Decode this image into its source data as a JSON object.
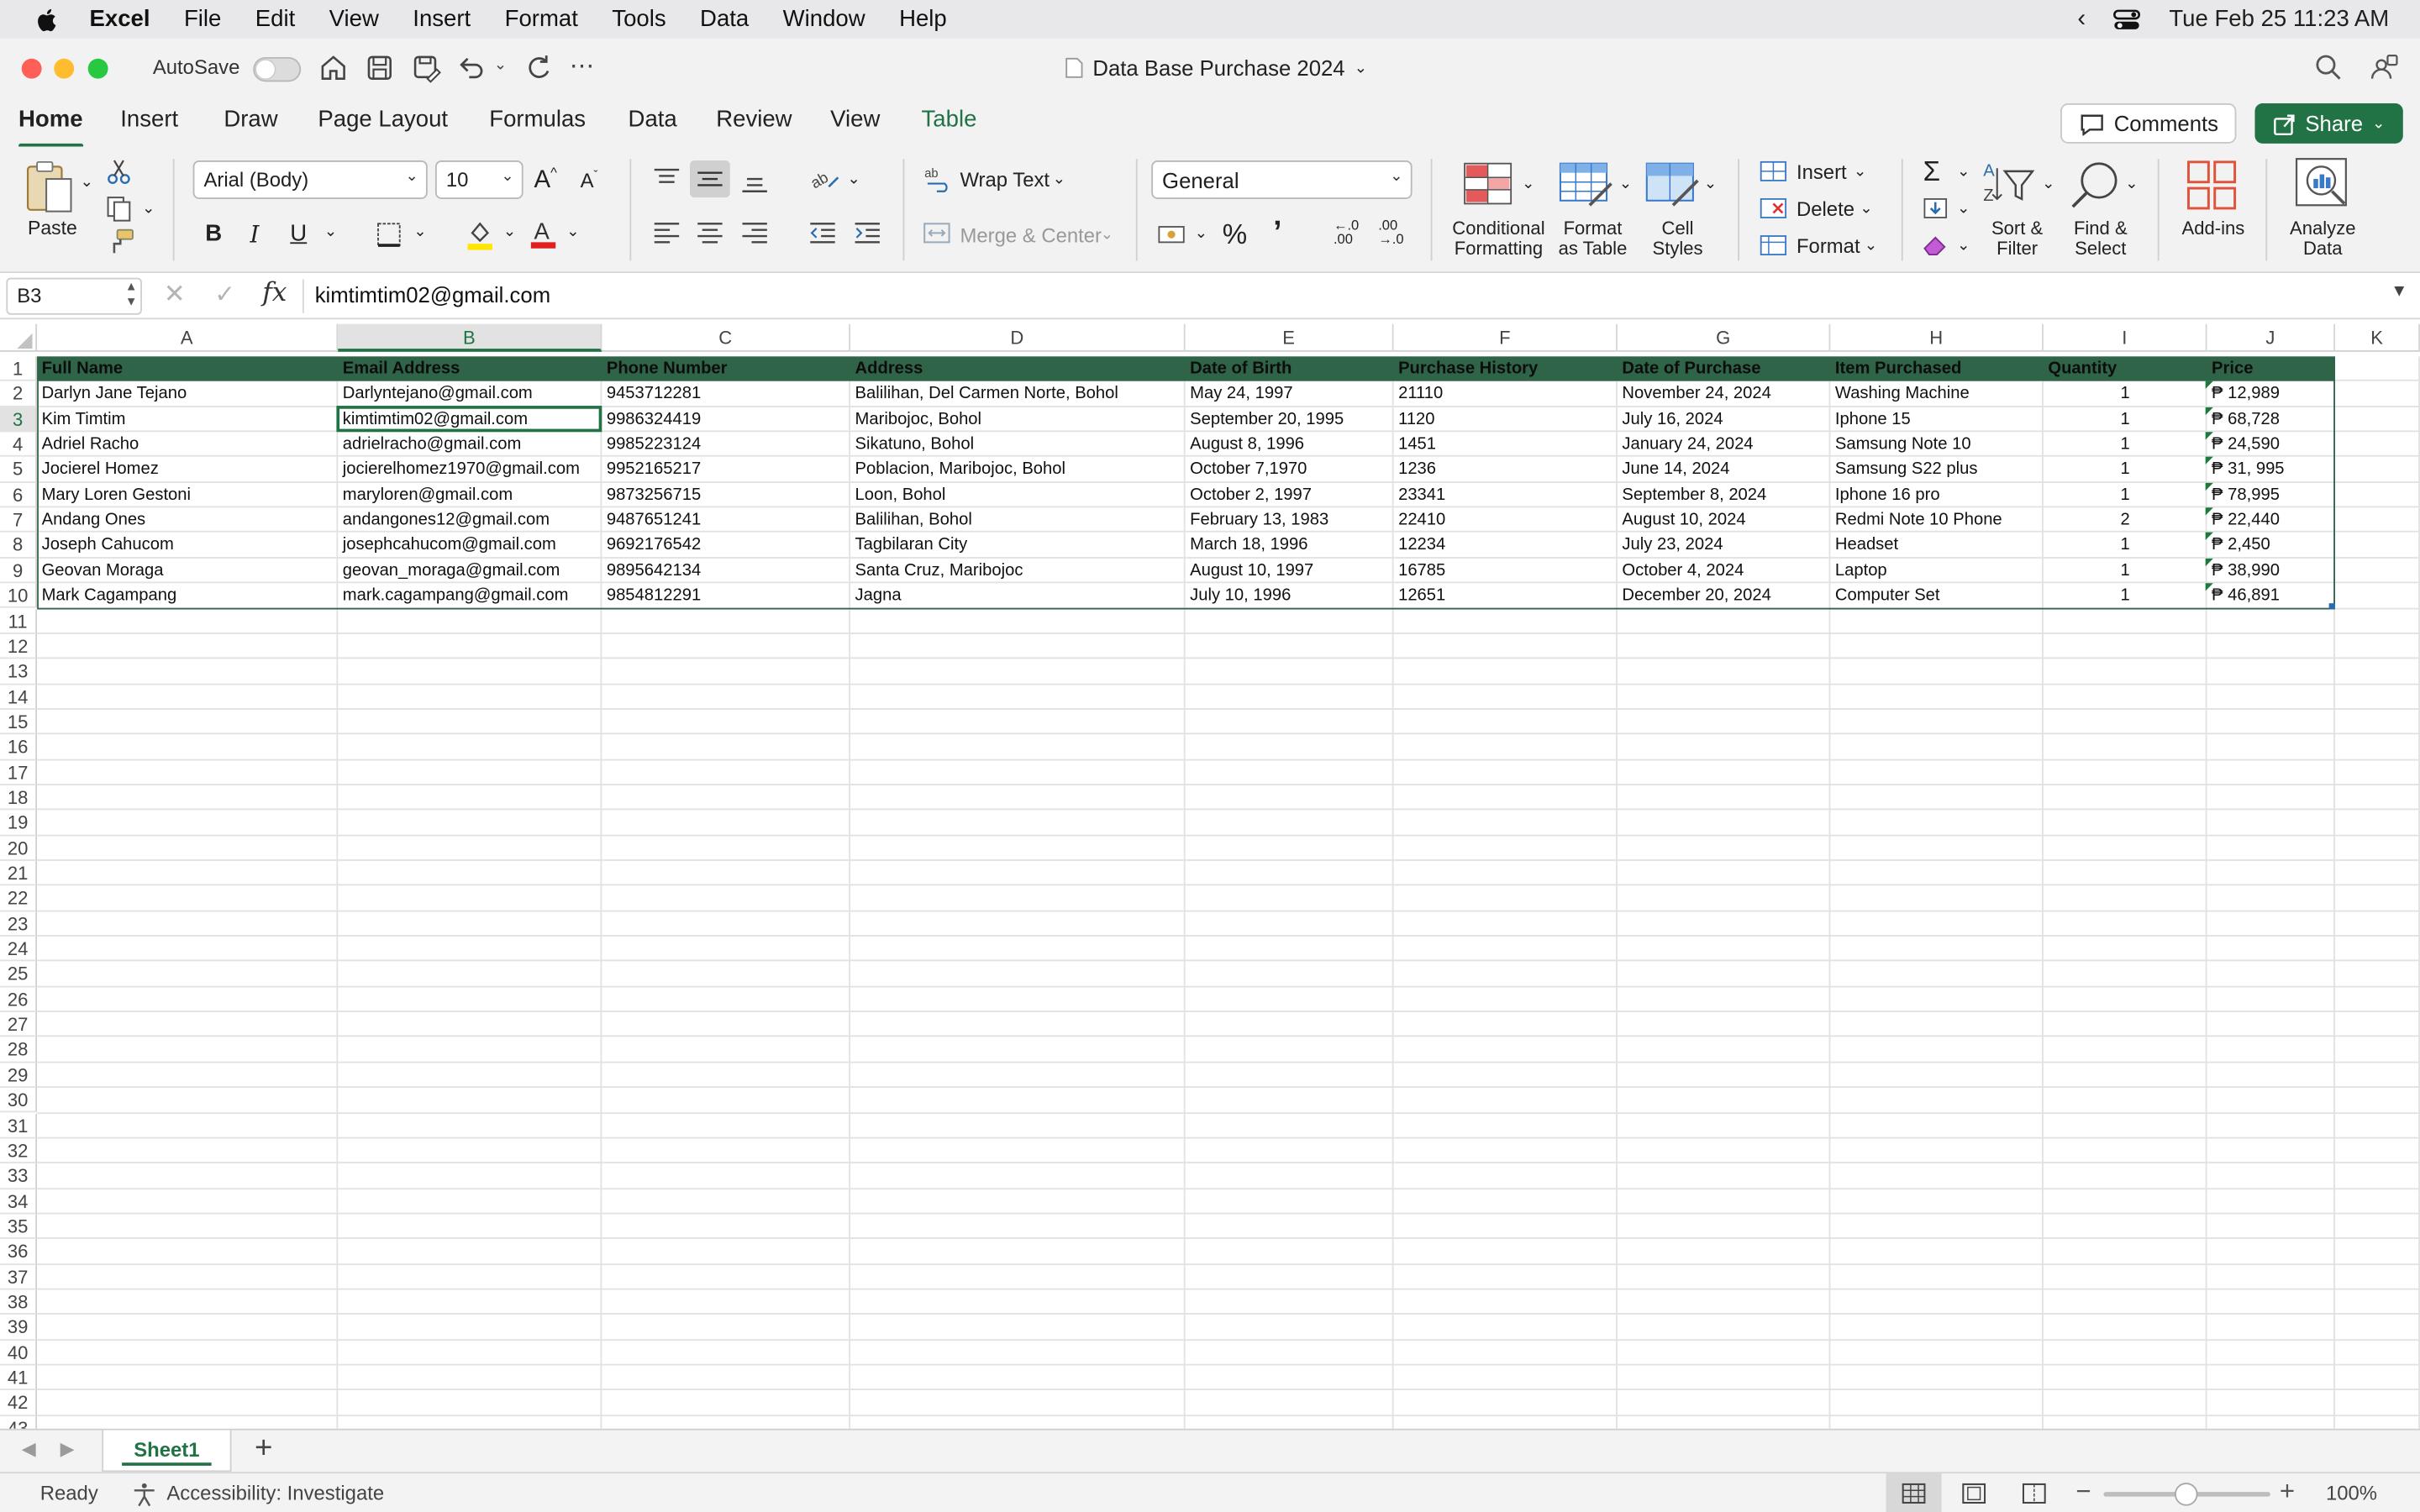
{
  "menubar": {
    "app": "Excel",
    "items": [
      "File",
      "Edit",
      "View",
      "Insert",
      "Format",
      "Tools",
      "Data",
      "Window",
      "Help"
    ],
    "clock": "Tue Feb 25  11:23 AM"
  },
  "titlebar": {
    "autosave": "AutoSave",
    "document": "Data Base Purchase 2024"
  },
  "ribbon_tabs": [
    "Home",
    "Insert",
    "Draw",
    "Page Layout",
    "Formulas",
    "Data",
    "Review",
    "View",
    "Table"
  ],
  "active_tab": "Home",
  "buttons": {
    "comments": "Comments",
    "share": "Share"
  },
  "ribbon": {
    "paste": "Paste",
    "font_name": "Arial (Body)",
    "font_size": "10",
    "wrap_text": "Wrap Text",
    "merge_center": "Merge & Center",
    "number_format": "General",
    "conditional": [
      "Conditional",
      "Formatting"
    ],
    "format_table": [
      "Format",
      "as Table"
    ],
    "cell_styles": [
      "Cell",
      "Styles"
    ],
    "insert": "Insert",
    "delete": "Delete",
    "format": "Format",
    "sort_filter": [
      "Sort &",
      "Filter"
    ],
    "find_select": [
      "Find &",
      "Select"
    ],
    "addins": "Add-ins",
    "analyze": [
      "Analyze",
      "Data"
    ]
  },
  "formula_bar": {
    "name_box": "B3",
    "value": "kimtimtim02@gmail.com"
  },
  "columns": [
    "A",
    "B",
    "C",
    "D",
    "E",
    "F",
    "G",
    "H",
    "I",
    "J",
    "K"
  ],
  "selected_column": "B",
  "selected_row": 3,
  "headers": [
    "Full Name",
    "Email Address",
    "Phone Number",
    "Address",
    "Date of Birth",
    "Purchase History",
    "Date of Purchase",
    "Item Purchased",
    "Quantity",
    "Price"
  ],
  "rows": [
    [
      "Darlyn Jane Tejano",
      "Darlyntejano@gmail.com",
      "9453712281",
      "Balilihan, Del Carmen Norte, Bohol",
      "May 24, 1997",
      "21110",
      "November 24, 2024",
      "Washing Machine",
      "1",
      "₱ 12,989"
    ],
    [
      "Kim Timtim",
      "kimtimtim02@gmail.com",
      "9986324419",
      "Maribojoc, Bohol",
      "September 20, 1995",
      "1120",
      "July 16, 2024",
      "Iphone 15",
      "1",
      "₱ 68,728"
    ],
    [
      "Adriel Racho",
      "adrielracho@gmail.com",
      "9985223124",
      "Sikatuno, Bohol",
      "August 8, 1996",
      "1451",
      "January 24, 2024",
      "Samsung Note 10",
      "1",
      "₱ 24,590"
    ],
    [
      "Jocierel Homez",
      "jocierelhomez1970@gmail.com",
      "9952165217",
      "Poblacion, Maribojoc, Bohol",
      "October 7,1970",
      "1236",
      "June 14, 2024",
      "Samsung  S22 plus",
      "1",
      "₱ 31, 995"
    ],
    [
      "Mary Loren Gestoni",
      "maryloren@gmail.com",
      "9873256715",
      "Loon, Bohol",
      "October 2, 1997",
      "23341",
      "September 8, 2024",
      "Iphone 16 pro",
      "1",
      "₱ 78,995"
    ],
    [
      "Andang Ones",
      "andangones12@gmail.com",
      "9487651241",
      "Balilihan, Bohol",
      "February 13, 1983",
      "22410",
      "August 10, 2024",
      "Redmi Note 10 Phone",
      "2",
      "₱ 22,440"
    ],
    [
      "Joseph Cahucom",
      "josephcahucom@gmail.com",
      "9692176542",
      "Tagbilaran City",
      "March 18, 1996",
      "12234",
      "July 23, 2024",
      "Headset",
      "1",
      "₱ 2,450"
    ],
    [
      "Geovan Moraga",
      "geovan_moraga@gmail.com",
      "9895642134",
      "Santa Cruz, Maribojoc",
      "August 10, 1997",
      "16785",
      "October 4, 2024",
      "Laptop",
      "1",
      "₱ 38,990"
    ],
    [
      "Mark Cagampang",
      "mark.cagampang@gmail.com",
      "9854812291",
      "Jagna",
      "July 10, 1996",
      "12651",
      "December 20, 2024",
      "Computer Set",
      "1",
      "₱ 46,891"
    ]
  ],
  "row_count": 42,
  "sheet_tab": "Sheet1",
  "status": {
    "ready": "Ready",
    "accessibility": "Accessibility: Investigate",
    "zoom": "100%"
  },
  "colors": {
    "accent": "#217346",
    "table_header": "#2f6448",
    "close": "#ff5f57",
    "minimize": "#febc2e",
    "maximize": "#28c840"
  }
}
